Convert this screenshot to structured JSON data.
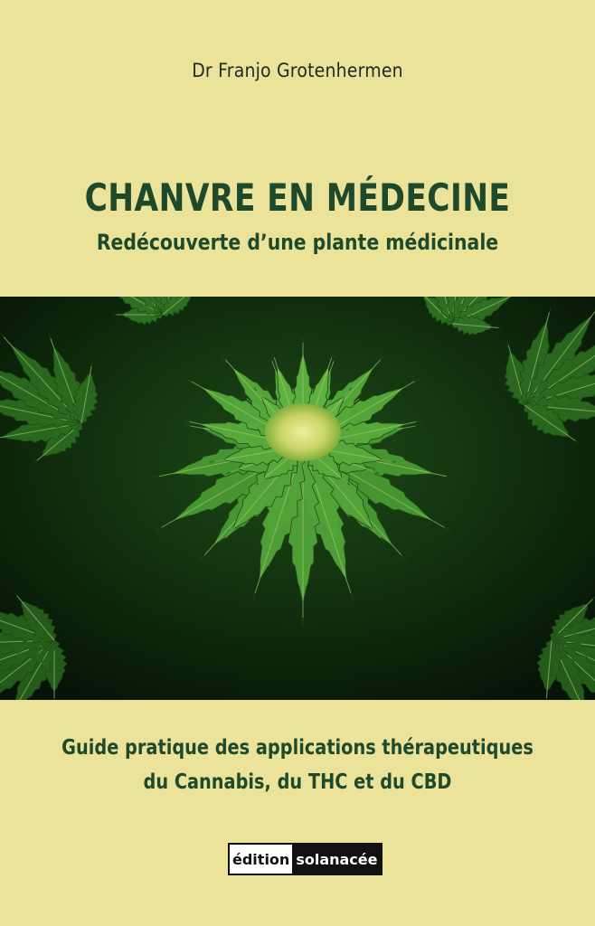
{
  "cover": {
    "author": "Dr Franjo Grotenhermen",
    "title": "CHANVRE EN MÉDECINE",
    "subtitle": "Redécouverte d’une plante médicinale",
    "guide_line1": "Guide pratique des applications thérapeutiques",
    "guide_line2": "du Cannabis, du THC et du CBD",
    "publisher_part1": "édition",
    "publisher_part2": "solanacée",
    "image": "cannabis-plant-photo",
    "colors": {
      "background": "#ebe39a",
      "title_text": "#1e4a2b",
      "leaf_green": "#3f8f2e",
      "bud_yellow": "#d8df7a"
    }
  }
}
